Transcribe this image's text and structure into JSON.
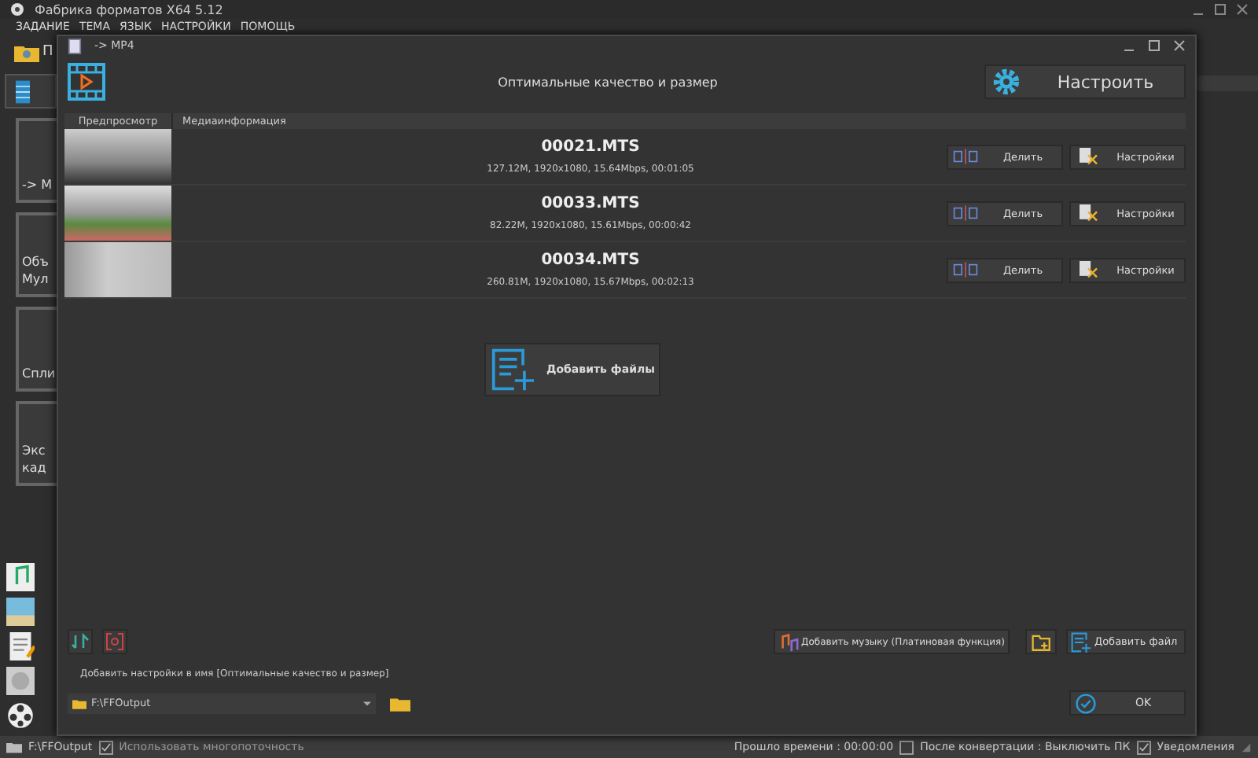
{
  "app": {
    "title": "Фабрика форматов X64 5.12",
    "menu": [
      "ЗАДАНИЕ",
      "ТЕМА",
      "ЯЗЫК",
      "НАСТРОЙКИ",
      "ПОМОЩЬ"
    ],
    "folder_label": "П",
    "sidebar_tiles": [
      {
        "lines": [
          "-> M"
        ]
      },
      {
        "lines": [
          "Объ",
          "Мул"
        ]
      },
      {
        "lines": [
          "Спли"
        ]
      },
      {
        "lines": [
          "Экс",
          "кад"
        ]
      }
    ],
    "status_bar": {
      "path": "F:\\FFOutput",
      "multithread": {
        "label": "Использовать многопоточность",
        "checked": true
      },
      "elapsed": "Прошло времени : 00:00:00",
      "shutdown": {
        "label": "После конвертации : Выключить ПК",
        "checked": false
      },
      "notify": {
        "label": "Уведомления",
        "checked": true
      }
    }
  },
  "dialog": {
    "title": "-> MP4",
    "profile": "Оптимальные качество и размер",
    "configure": "Настроить",
    "columns": [
      "Предпросмотр",
      "Медиаинформация"
    ],
    "files": [
      {
        "name": "00021.MTS",
        "info": "127.12M, 1920x1080, 15.64Mbps, 00:01:05",
        "split": "Делить",
        "settings": "Настройки"
      },
      {
        "name": "00033.MTS",
        "info": "82.22M, 1920x1080, 15.61Mbps, 00:00:42",
        "split": "Делить",
        "settings": "Настройки"
      },
      {
        "name": "00034.MTS",
        "info": "260.81M, 1920x1080, 15.67Mbps, 00:02:13",
        "split": "Делить",
        "settings": "Настройки"
      }
    ],
    "add_files_big": "Добавить файлы",
    "add_music": "Добавить музыку (Платиновая функция)",
    "add_files": "Добавить файл",
    "name_option": "Добавить настройки в имя [Оптимальные качество и размер]",
    "output_path": "F:\\FFOutput",
    "ok": "OK"
  }
}
